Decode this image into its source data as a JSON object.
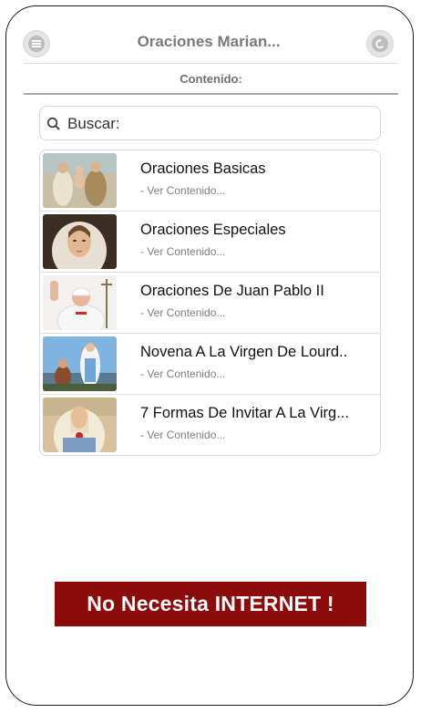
{
  "header": {
    "title": "Oraciones Marian...",
    "menu_icon": "hamburger-menu-icon",
    "back_icon": "back-arrow-icon"
  },
  "subheader": {
    "label": "Contenido:"
  },
  "search": {
    "placeholder": "Buscar:",
    "icon": "search-icon"
  },
  "list": {
    "items": [
      {
        "title": "Oraciones Basicas",
        "subtitle": "- Ver Contenido..."
      },
      {
        "title": "Oraciones Especiales",
        "subtitle": "- Ver Contenido..."
      },
      {
        "title": "Oraciones De Juan Pablo II",
        "subtitle": "- Ver Contenido..."
      },
      {
        "title": "Novena A La Virgen De Lourd..",
        "subtitle": "- Ver Contenido..."
      },
      {
        "title": "7 Formas De Invitar A La Virg...",
        "subtitle": "- Ver Contenido..."
      }
    ]
  },
  "banner": {
    "text": "No Necesita INTERNET !"
  },
  "colors": {
    "banner_bg": "#8b0a0a",
    "title_gray": "#7a7a7a"
  }
}
